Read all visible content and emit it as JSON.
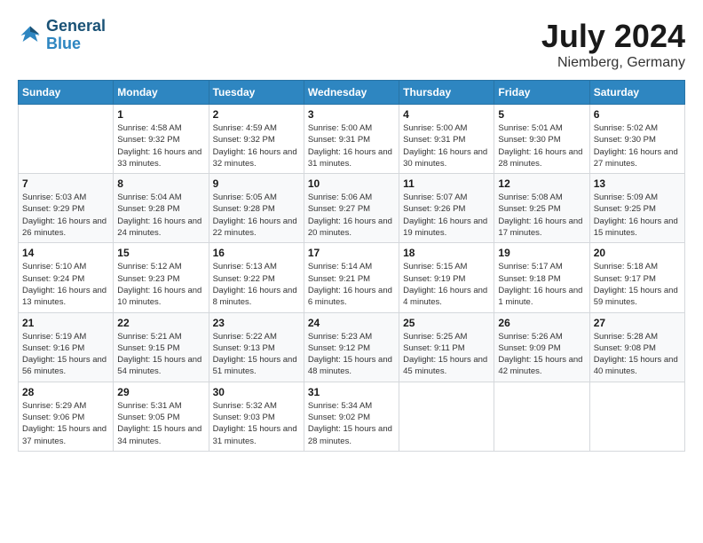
{
  "header": {
    "logo_line1": "General",
    "logo_line2": "Blue",
    "month": "July 2024",
    "location": "Niemberg, Germany"
  },
  "weekdays": [
    "Sunday",
    "Monday",
    "Tuesday",
    "Wednesday",
    "Thursday",
    "Friday",
    "Saturday"
  ],
  "weeks": [
    [
      {
        "day": "",
        "sunrise": "",
        "sunset": "",
        "daylight": ""
      },
      {
        "day": "1",
        "sunrise": "Sunrise: 4:58 AM",
        "sunset": "Sunset: 9:32 PM",
        "daylight": "Daylight: 16 hours and 33 minutes."
      },
      {
        "day": "2",
        "sunrise": "Sunrise: 4:59 AM",
        "sunset": "Sunset: 9:32 PM",
        "daylight": "Daylight: 16 hours and 32 minutes."
      },
      {
        "day": "3",
        "sunrise": "Sunrise: 5:00 AM",
        "sunset": "Sunset: 9:31 PM",
        "daylight": "Daylight: 16 hours and 31 minutes."
      },
      {
        "day": "4",
        "sunrise": "Sunrise: 5:00 AM",
        "sunset": "Sunset: 9:31 PM",
        "daylight": "Daylight: 16 hours and 30 minutes."
      },
      {
        "day": "5",
        "sunrise": "Sunrise: 5:01 AM",
        "sunset": "Sunset: 9:30 PM",
        "daylight": "Daylight: 16 hours and 28 minutes."
      },
      {
        "day": "6",
        "sunrise": "Sunrise: 5:02 AM",
        "sunset": "Sunset: 9:30 PM",
        "daylight": "Daylight: 16 hours and 27 minutes."
      }
    ],
    [
      {
        "day": "7",
        "sunrise": "Sunrise: 5:03 AM",
        "sunset": "Sunset: 9:29 PM",
        "daylight": "Daylight: 16 hours and 26 minutes."
      },
      {
        "day": "8",
        "sunrise": "Sunrise: 5:04 AM",
        "sunset": "Sunset: 9:28 PM",
        "daylight": "Daylight: 16 hours and 24 minutes."
      },
      {
        "day": "9",
        "sunrise": "Sunrise: 5:05 AM",
        "sunset": "Sunset: 9:28 PM",
        "daylight": "Daylight: 16 hours and 22 minutes."
      },
      {
        "day": "10",
        "sunrise": "Sunrise: 5:06 AM",
        "sunset": "Sunset: 9:27 PM",
        "daylight": "Daylight: 16 hours and 20 minutes."
      },
      {
        "day": "11",
        "sunrise": "Sunrise: 5:07 AM",
        "sunset": "Sunset: 9:26 PM",
        "daylight": "Daylight: 16 hours and 19 minutes."
      },
      {
        "day": "12",
        "sunrise": "Sunrise: 5:08 AM",
        "sunset": "Sunset: 9:25 PM",
        "daylight": "Daylight: 16 hours and 17 minutes."
      },
      {
        "day": "13",
        "sunrise": "Sunrise: 5:09 AM",
        "sunset": "Sunset: 9:25 PM",
        "daylight": "Daylight: 16 hours and 15 minutes."
      }
    ],
    [
      {
        "day": "14",
        "sunrise": "Sunrise: 5:10 AM",
        "sunset": "Sunset: 9:24 PM",
        "daylight": "Daylight: 16 hours and 13 minutes."
      },
      {
        "day": "15",
        "sunrise": "Sunrise: 5:12 AM",
        "sunset": "Sunset: 9:23 PM",
        "daylight": "Daylight: 16 hours and 10 minutes."
      },
      {
        "day": "16",
        "sunrise": "Sunrise: 5:13 AM",
        "sunset": "Sunset: 9:22 PM",
        "daylight": "Daylight: 16 hours and 8 minutes."
      },
      {
        "day": "17",
        "sunrise": "Sunrise: 5:14 AM",
        "sunset": "Sunset: 9:21 PM",
        "daylight": "Daylight: 16 hours and 6 minutes."
      },
      {
        "day": "18",
        "sunrise": "Sunrise: 5:15 AM",
        "sunset": "Sunset: 9:19 PM",
        "daylight": "Daylight: 16 hours and 4 minutes."
      },
      {
        "day": "19",
        "sunrise": "Sunrise: 5:17 AM",
        "sunset": "Sunset: 9:18 PM",
        "daylight": "Daylight: 16 hours and 1 minute."
      },
      {
        "day": "20",
        "sunrise": "Sunrise: 5:18 AM",
        "sunset": "Sunset: 9:17 PM",
        "daylight": "Daylight: 15 hours and 59 minutes."
      }
    ],
    [
      {
        "day": "21",
        "sunrise": "Sunrise: 5:19 AM",
        "sunset": "Sunset: 9:16 PM",
        "daylight": "Daylight: 15 hours and 56 minutes."
      },
      {
        "day": "22",
        "sunrise": "Sunrise: 5:21 AM",
        "sunset": "Sunset: 9:15 PM",
        "daylight": "Daylight: 15 hours and 54 minutes."
      },
      {
        "day": "23",
        "sunrise": "Sunrise: 5:22 AM",
        "sunset": "Sunset: 9:13 PM",
        "daylight": "Daylight: 15 hours and 51 minutes."
      },
      {
        "day": "24",
        "sunrise": "Sunrise: 5:23 AM",
        "sunset": "Sunset: 9:12 PM",
        "daylight": "Daylight: 15 hours and 48 minutes."
      },
      {
        "day": "25",
        "sunrise": "Sunrise: 5:25 AM",
        "sunset": "Sunset: 9:11 PM",
        "daylight": "Daylight: 15 hours and 45 minutes."
      },
      {
        "day": "26",
        "sunrise": "Sunrise: 5:26 AM",
        "sunset": "Sunset: 9:09 PM",
        "daylight": "Daylight: 15 hours and 42 minutes."
      },
      {
        "day": "27",
        "sunrise": "Sunrise: 5:28 AM",
        "sunset": "Sunset: 9:08 PM",
        "daylight": "Daylight: 15 hours and 40 minutes."
      }
    ],
    [
      {
        "day": "28",
        "sunrise": "Sunrise: 5:29 AM",
        "sunset": "Sunset: 9:06 PM",
        "daylight": "Daylight: 15 hours and 37 minutes."
      },
      {
        "day": "29",
        "sunrise": "Sunrise: 5:31 AM",
        "sunset": "Sunset: 9:05 PM",
        "daylight": "Daylight: 15 hours and 34 minutes."
      },
      {
        "day": "30",
        "sunrise": "Sunrise: 5:32 AM",
        "sunset": "Sunset: 9:03 PM",
        "daylight": "Daylight: 15 hours and 31 minutes."
      },
      {
        "day": "31",
        "sunrise": "Sunrise: 5:34 AM",
        "sunset": "Sunset: 9:02 PM",
        "daylight": "Daylight: 15 hours and 28 minutes."
      },
      {
        "day": "",
        "sunrise": "",
        "sunset": "",
        "daylight": ""
      },
      {
        "day": "",
        "sunrise": "",
        "sunset": "",
        "daylight": ""
      },
      {
        "day": "",
        "sunrise": "",
        "sunset": "",
        "daylight": ""
      }
    ]
  ]
}
